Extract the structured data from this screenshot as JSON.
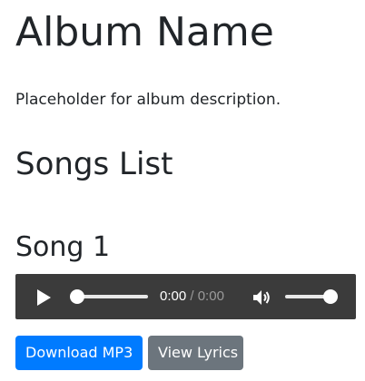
{
  "album": {
    "title": "Album Name",
    "description": "Placeholder for album description."
  },
  "songs_heading": "Songs List",
  "songs": [
    {
      "title": "Song 1",
      "player": {
        "current_time": "0:00",
        "separator": " / ",
        "duration": "0:00",
        "progress_fraction": 0,
        "volume_fraction": 1,
        "play_icon": "play-icon",
        "volume_icon": "volume-icon"
      },
      "buttons": {
        "download_label": "Download MP3",
        "lyrics_label": "View Lyrics"
      }
    }
  ],
  "colors": {
    "primary": "#007bff",
    "secondary": "#6c757d",
    "player_bg": "#3b3b3b",
    "text": "#212529"
  }
}
